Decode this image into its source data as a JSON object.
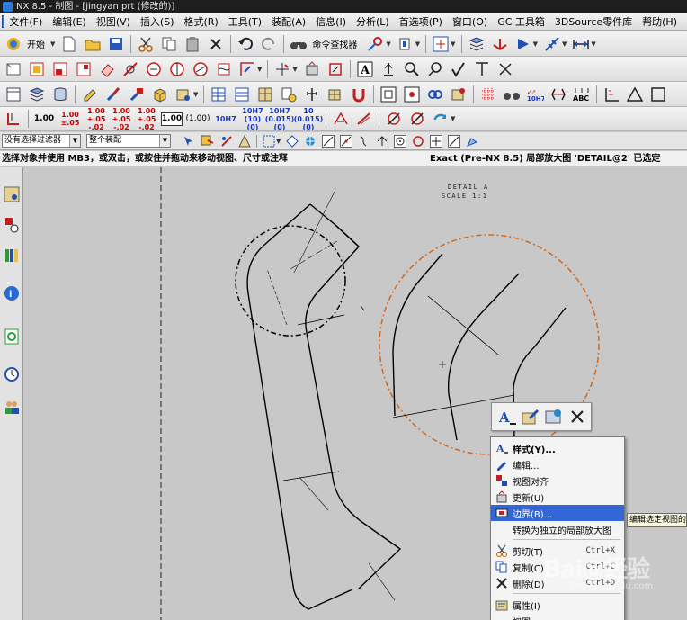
{
  "window": {
    "title": "NX 8.5 - 制图 - [jingyan.prt (修改的)]"
  },
  "menubar": {
    "items": [
      "文件(F)",
      "编辑(E)",
      "视图(V)",
      "插入(S)",
      "格式(R)",
      "工具(T)",
      "装配(A)",
      "信息(I)",
      "分析(L)",
      "首选项(P)",
      "窗口(O)",
      "GC 工具箱",
      "3DSource零件库",
      "帮助(H)"
    ]
  },
  "toolbar1": {
    "start_label": "开始",
    "command_finder_label": "命令查找器"
  },
  "format_toolbar": {
    "items": [
      "1.00",
      "1.00\n±.05",
      "1.00\n+.05\n-.02",
      "1.00\n+.05\n-.02",
      "1.00\n+.05\n-.02",
      "1.00",
      "(1.00)",
      "10H7",
      "10H7\n(10)\n(0)",
      "10H7\n(0.015)\n(0)",
      "10\n(0.015)\n(0)"
    ]
  },
  "selection_bar": {
    "filter_value": "没有选择过滤器",
    "scope_value": "整个装配"
  },
  "status": {
    "prompt": "选择对象并使用 MB3，或双击，或按住并拖动来移动视图、尺寸或注释",
    "message": "Exact (Pre-NX 8.5) 局部放大图 'DETAIL@2' 已选定"
  },
  "drawing": {
    "detail_label": "DETAIL A",
    "scale_label": "SCALE 1:1"
  },
  "context_menu": {
    "items": [
      {
        "label": "样式(Y)...",
        "shortcut": "",
        "icon": "style-icon"
      },
      {
        "label": "编辑...",
        "shortcut": "",
        "icon": "edit-icon"
      },
      {
        "label": "视图对齐",
        "shortcut": "",
        "icon": "align-icon"
      },
      {
        "label": "更新(U)",
        "shortcut": "",
        "icon": "update-icon"
      },
      {
        "label": "边界(B)...",
        "shortcut": "",
        "icon": "boundary-icon"
      },
      {
        "label": "转换为独立的局部放大图",
        "shortcut": "",
        "icon": ""
      },
      {
        "label": "剪切(T)",
        "shortcut": "Ctrl+X",
        "icon": "cut-icon"
      },
      {
        "label": "复制(C)",
        "shortcut": "Ctrl+C",
        "icon": "copy-icon"
      },
      {
        "label": "删除(D)",
        "shortcut": "Ctrl+D",
        "icon": "delete-icon"
      },
      {
        "label": "属性(I)",
        "shortcut": "",
        "icon": "properties-icon"
      },
      {
        "label": "视图",
        "shortcut": "",
        "icon": ""
      }
    ]
  },
  "tooltip": {
    "text": "编辑选定视图的"
  },
  "watermark": {
    "main": "Bai@经验",
    "sub": "jingyan.baidu.com"
  },
  "colors": {
    "highlight": "#3366d6",
    "detail_circle": "#d2691e",
    "geometry": "#000000",
    "background": "#c8c8c8"
  }
}
